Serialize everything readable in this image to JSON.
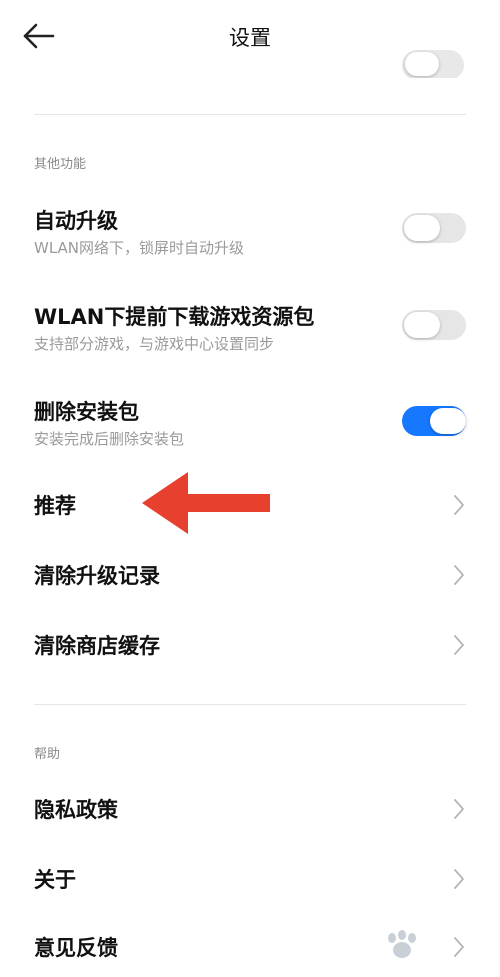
{
  "header": {
    "title": "设置"
  },
  "sections": {
    "other": {
      "header": "其他功能"
    },
    "help": {
      "header": "帮助"
    }
  },
  "rows": {
    "auto_upgrade": {
      "title": "自动升级",
      "subtitle": "WLAN网络下，锁屏时自动升级",
      "enabled": false
    },
    "preload_resources": {
      "title": "WLAN下提前下载游戏资源包",
      "subtitle": "支持部分游戏，与游戏中心设置同步",
      "enabled": false
    },
    "delete_package": {
      "title": "删除安装包",
      "subtitle": "安装完成后删除安装包",
      "enabled": true
    },
    "recommend": {
      "title": "推荐"
    },
    "clear_upgrade_records": {
      "title": "清除升级记录"
    },
    "clear_store_cache": {
      "title": "清除商店缓存"
    },
    "privacy_policy": {
      "title": "隐私政策"
    },
    "about": {
      "title": "关于"
    },
    "feedback": {
      "title": "意见反馈"
    }
  },
  "colors": {
    "toggle_on": "#1677ff",
    "toggle_off": "#e6e6e6",
    "annotation_arrow": "#e8402f"
  },
  "icons": {
    "back": "arrow-left-icon",
    "chevron": "chevron-right-icon",
    "annotation": "red-arrow-annotation",
    "watermark": "baidu-watermark"
  }
}
